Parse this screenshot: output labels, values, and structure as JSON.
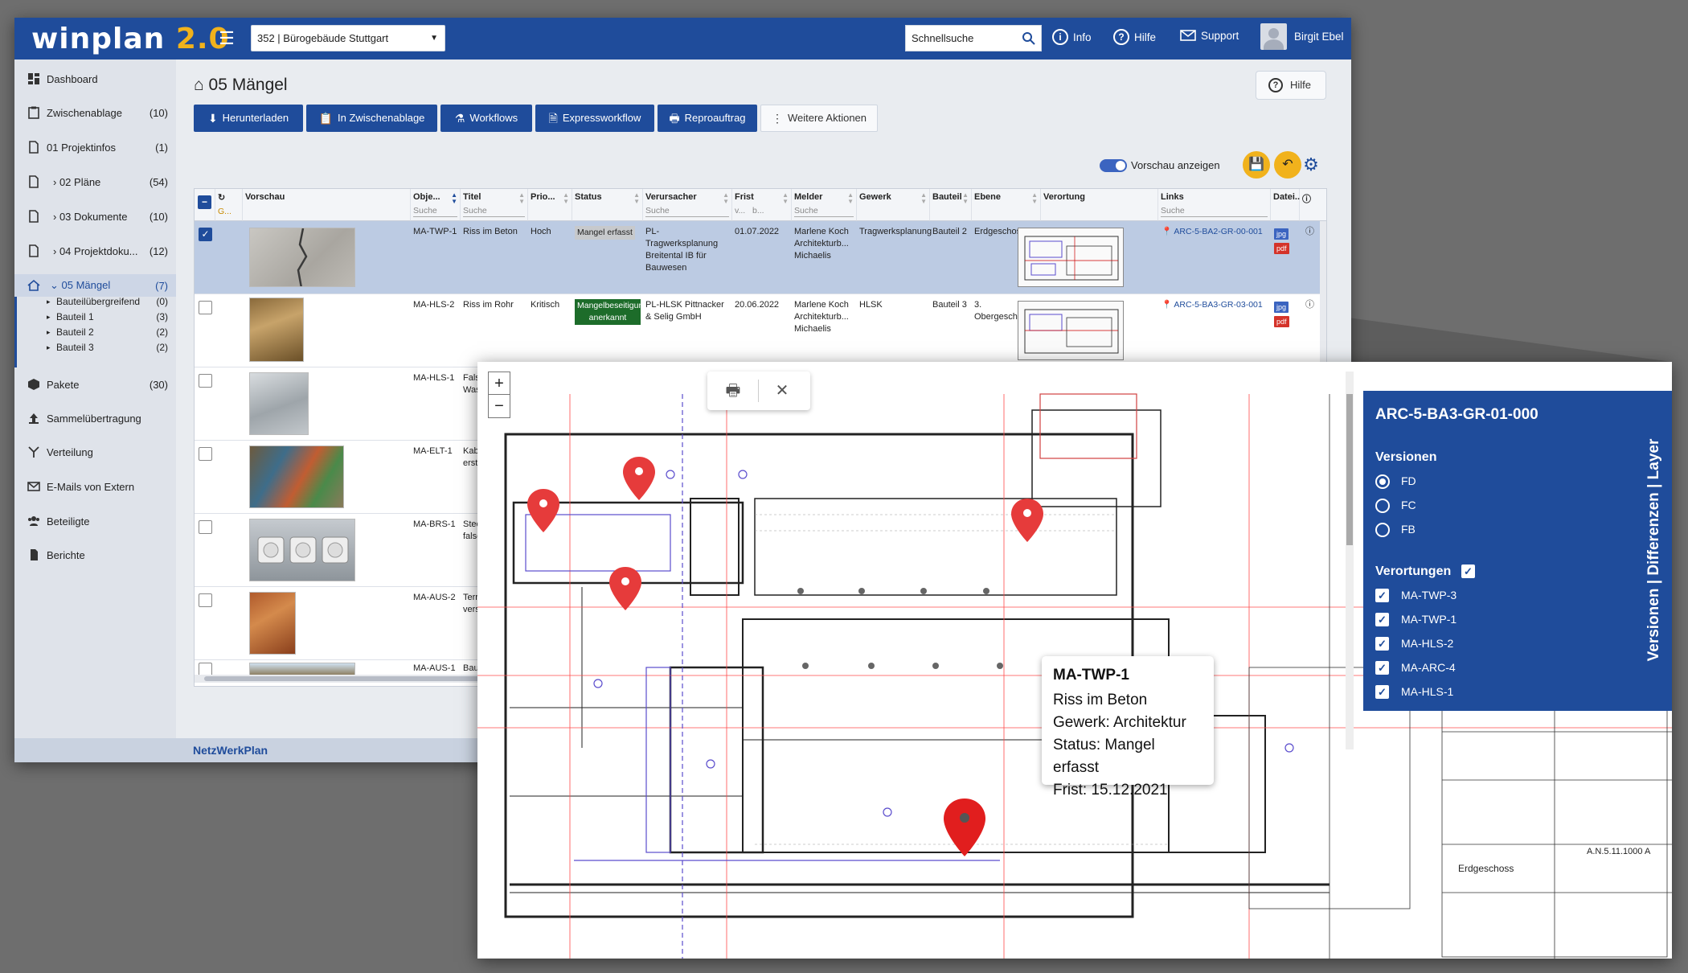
{
  "app": {
    "logo_main": "winplan",
    "logo_version": "2.0",
    "project": "352 | Bürogebäude Stuttgart",
    "search_placeholder": "Schnellsuche",
    "links": {
      "info": "Info",
      "help": "Hilfe",
      "support": "Support"
    },
    "user": "Birgit Ebel",
    "footer_brand": "NetzWerkPlan"
  },
  "sidebar": {
    "items": [
      {
        "label": "Dashboard",
        "count": ""
      },
      {
        "label": "Zwischenablage",
        "count": "(10)"
      },
      {
        "label": "01 Projektinfos",
        "count": "(1)"
      },
      {
        "label": "02 Pläne",
        "count": "(54)"
      },
      {
        "label": "03 Dokumente",
        "count": "(10)"
      },
      {
        "label": "04 Projektdoku...",
        "count": "(12)"
      },
      {
        "label": "05 Mängel",
        "count": "(7)"
      },
      {
        "label": "Pakete",
        "count": "(30)"
      },
      {
        "label": "Sammelübertragung",
        "count": ""
      },
      {
        "label": "Verteilung",
        "count": ""
      },
      {
        "label": "E-Mails von Extern",
        "count": ""
      },
      {
        "label": "Beteiligte",
        "count": ""
      },
      {
        "label": "Berichte",
        "count": ""
      }
    ],
    "subitems": [
      {
        "label": "Bauteilübergreifend",
        "count": "(0)"
      },
      {
        "label": "Bauteil 1",
        "count": "(3)"
      },
      {
        "label": "Bauteil 2",
        "count": "(2)"
      },
      {
        "label": "Bauteil 3",
        "count": "(2)"
      }
    ]
  },
  "page": {
    "title": "05 Mängel",
    "help_button": "Hilfe",
    "toolbar": [
      "Herunterladen",
      "In Zwischenablage",
      "Workflows",
      "Expressworkflow",
      "Reproauftrag",
      "Weitere Aktionen"
    ],
    "preview_label": "Vorschau anzeigen"
  },
  "table": {
    "headers": [
      "G...",
      "Vorschau",
      "Obje...",
      "Titel",
      "Prio...",
      "Status",
      "Verursacher",
      "Frist",
      "Melder",
      "Gewerk",
      "Bauteil",
      "Ebene",
      "Verortung",
      "Links",
      "Datei..."
    ],
    "search_label": "Suche",
    "frist_filters": [
      "v...",
      "b..."
    ],
    "rows": [
      {
        "id": "MA-TWP-1",
        "title": "Riss im Beton",
        "prio": "Hoch",
        "status": "Mangel erfasst",
        "causer": "PL-Tragwerksplanung Breitental IB für Bauwesen",
        "due": "01.07.2022",
        "reporter": "Marlene Koch Architekturb... Michaelis",
        "trade": "Tragwerksplanung",
        "part": "Bauteil 2",
        "level": "Erdgeschoss",
        "link": "ARC-5-BA2-GR-00-001"
      },
      {
        "id": "MA-HLS-2",
        "title": "Riss im Rohr",
        "prio": "Kritisch",
        "status": "Mangelbeseitigung anerkannt",
        "causer": "PL-HLSK Pittnacker & Selig GmbH",
        "due": "20.06.2022",
        "reporter": "Marlene Koch Architekturb... Michaelis",
        "trade": "HLSK",
        "part": "Bauteil 3",
        "level": "3. Obergeschoss",
        "link": "ARC-5-BA3-GR-03-001"
      },
      {
        "id": "MA-HLS-1",
        "title": "Falsche Wasserhähne"
      },
      {
        "id": "MA-ELT-1",
        "title": "Kabeltrasse erstellen"
      },
      {
        "id": "MA-BRS-1",
        "title": "Steckdose falsch platziert"
      },
      {
        "id": "MA-AUS-2",
        "title": "Terrasse verschmutzt"
      },
      {
        "id": "MA-AUS-1",
        "title": "Baugrube Kran"
      }
    ],
    "file_types": [
      "jpg",
      "pdf"
    ]
  },
  "plan": {
    "tooltip": {
      "title": "MA-TWP-1",
      "lines": [
        "Riss im Beton",
        "Gewerk: Architektur",
        "Status: Mangel erfasst",
        "Frist: 15.12.2021"
      ]
    },
    "panel": {
      "title": "ARC-5-BA3-GR-01-000",
      "versions_label": "Versionen",
      "versions": [
        "FD",
        "FC",
        "FB"
      ],
      "selected_version": "FD",
      "locations_label": "Verortungen",
      "locations": [
        "MA-TWP-3",
        "MA-TWP-1",
        "MA-HLS-2",
        "MA-ARC-4",
        "MA-HLS-1"
      ],
      "side_tab": "Versionen | Differenzen | Layer"
    },
    "title_block": {
      "level": "Erdgeschoss",
      "number": "A.N.5.11.1000 A"
    }
  },
  "colors": {
    "brand": "#1f4c9b",
    "accent": "#f1b21c",
    "pin": "#e63b3b",
    "pin_active": "#e11e1e"
  }
}
